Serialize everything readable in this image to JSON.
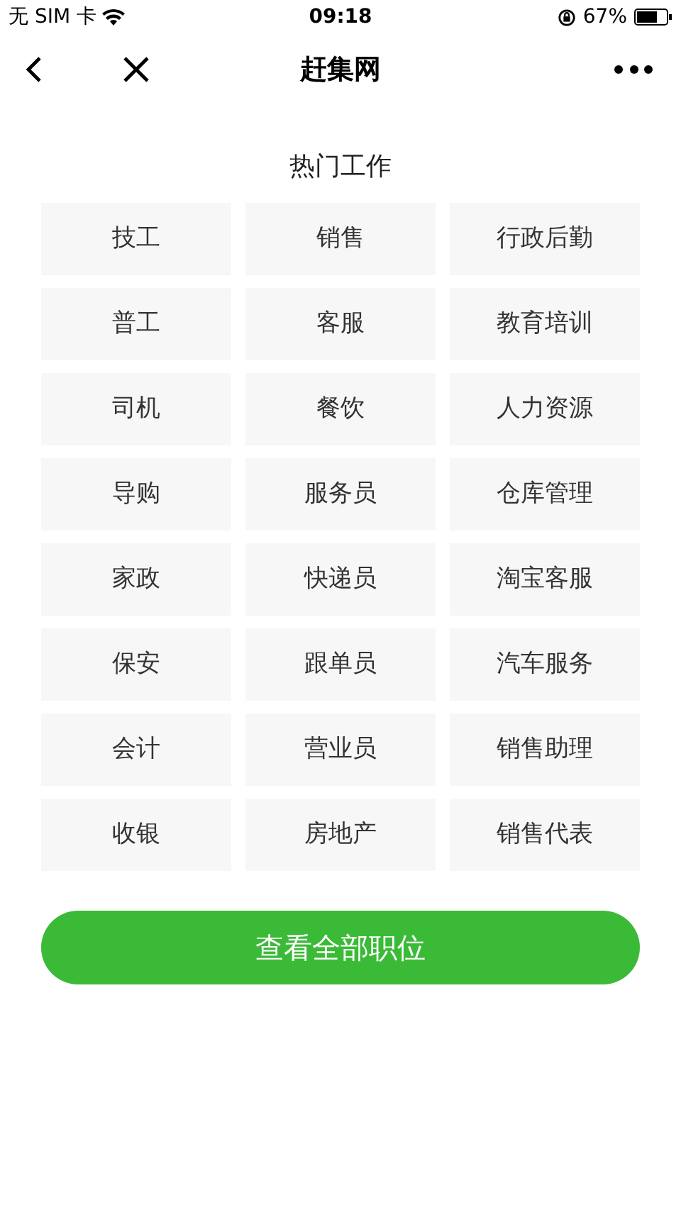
{
  "status_bar": {
    "carrier": "无 SIM 卡",
    "time": "09:18",
    "battery": "67%"
  },
  "nav": {
    "title": "赶集网"
  },
  "section": {
    "title": "热门工作",
    "jobs": [
      "技工",
      "销售",
      "行政后勤",
      "普工",
      "客服",
      "教育培训",
      "司机",
      "餐饮",
      "人力资源",
      "导购",
      "服务员",
      "仓库管理",
      "家政",
      "快递员",
      "淘宝客服",
      "保安",
      "跟单员",
      "汽车服务",
      "会计",
      "营业员",
      "销售助理",
      "收银",
      "房地产",
      "销售代表"
    ]
  },
  "button": {
    "label": "查看全部职位"
  }
}
